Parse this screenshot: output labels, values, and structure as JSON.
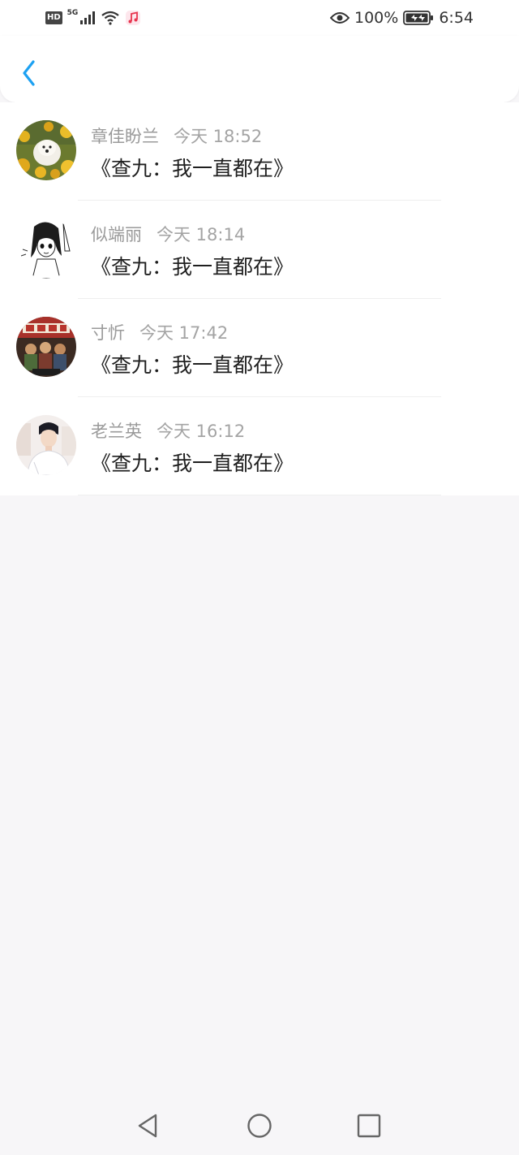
{
  "status_bar": {
    "hd": "HD",
    "network": "5G",
    "battery": "100%",
    "time": "6:54"
  },
  "header": {
    "back_icon": "chevron-left-icon",
    "accent": "#1da1f2"
  },
  "entries": [
    {
      "name": "章佳盼兰",
      "time": "今天 18:52",
      "message": "《查九：我一直都在》",
      "avatar": "dog-sunflowers"
    },
    {
      "name": "似端丽",
      "time": "今天 18:14",
      "message": "《查九：我一直都在》",
      "avatar": "manga-girl"
    },
    {
      "name": "寸忻",
      "time": "今天 17:42",
      "message": "《查九：我一直都在》",
      "avatar": "movie-poster"
    },
    {
      "name": "老兰英",
      "time": "今天 16:12",
      "message": "《查九：我一直都在》",
      "avatar": "young-man"
    }
  ],
  "nav_bar": {
    "back_icon": "triangle-back-icon",
    "home_icon": "circle-home-icon",
    "recents_icon": "square-recents-icon"
  }
}
